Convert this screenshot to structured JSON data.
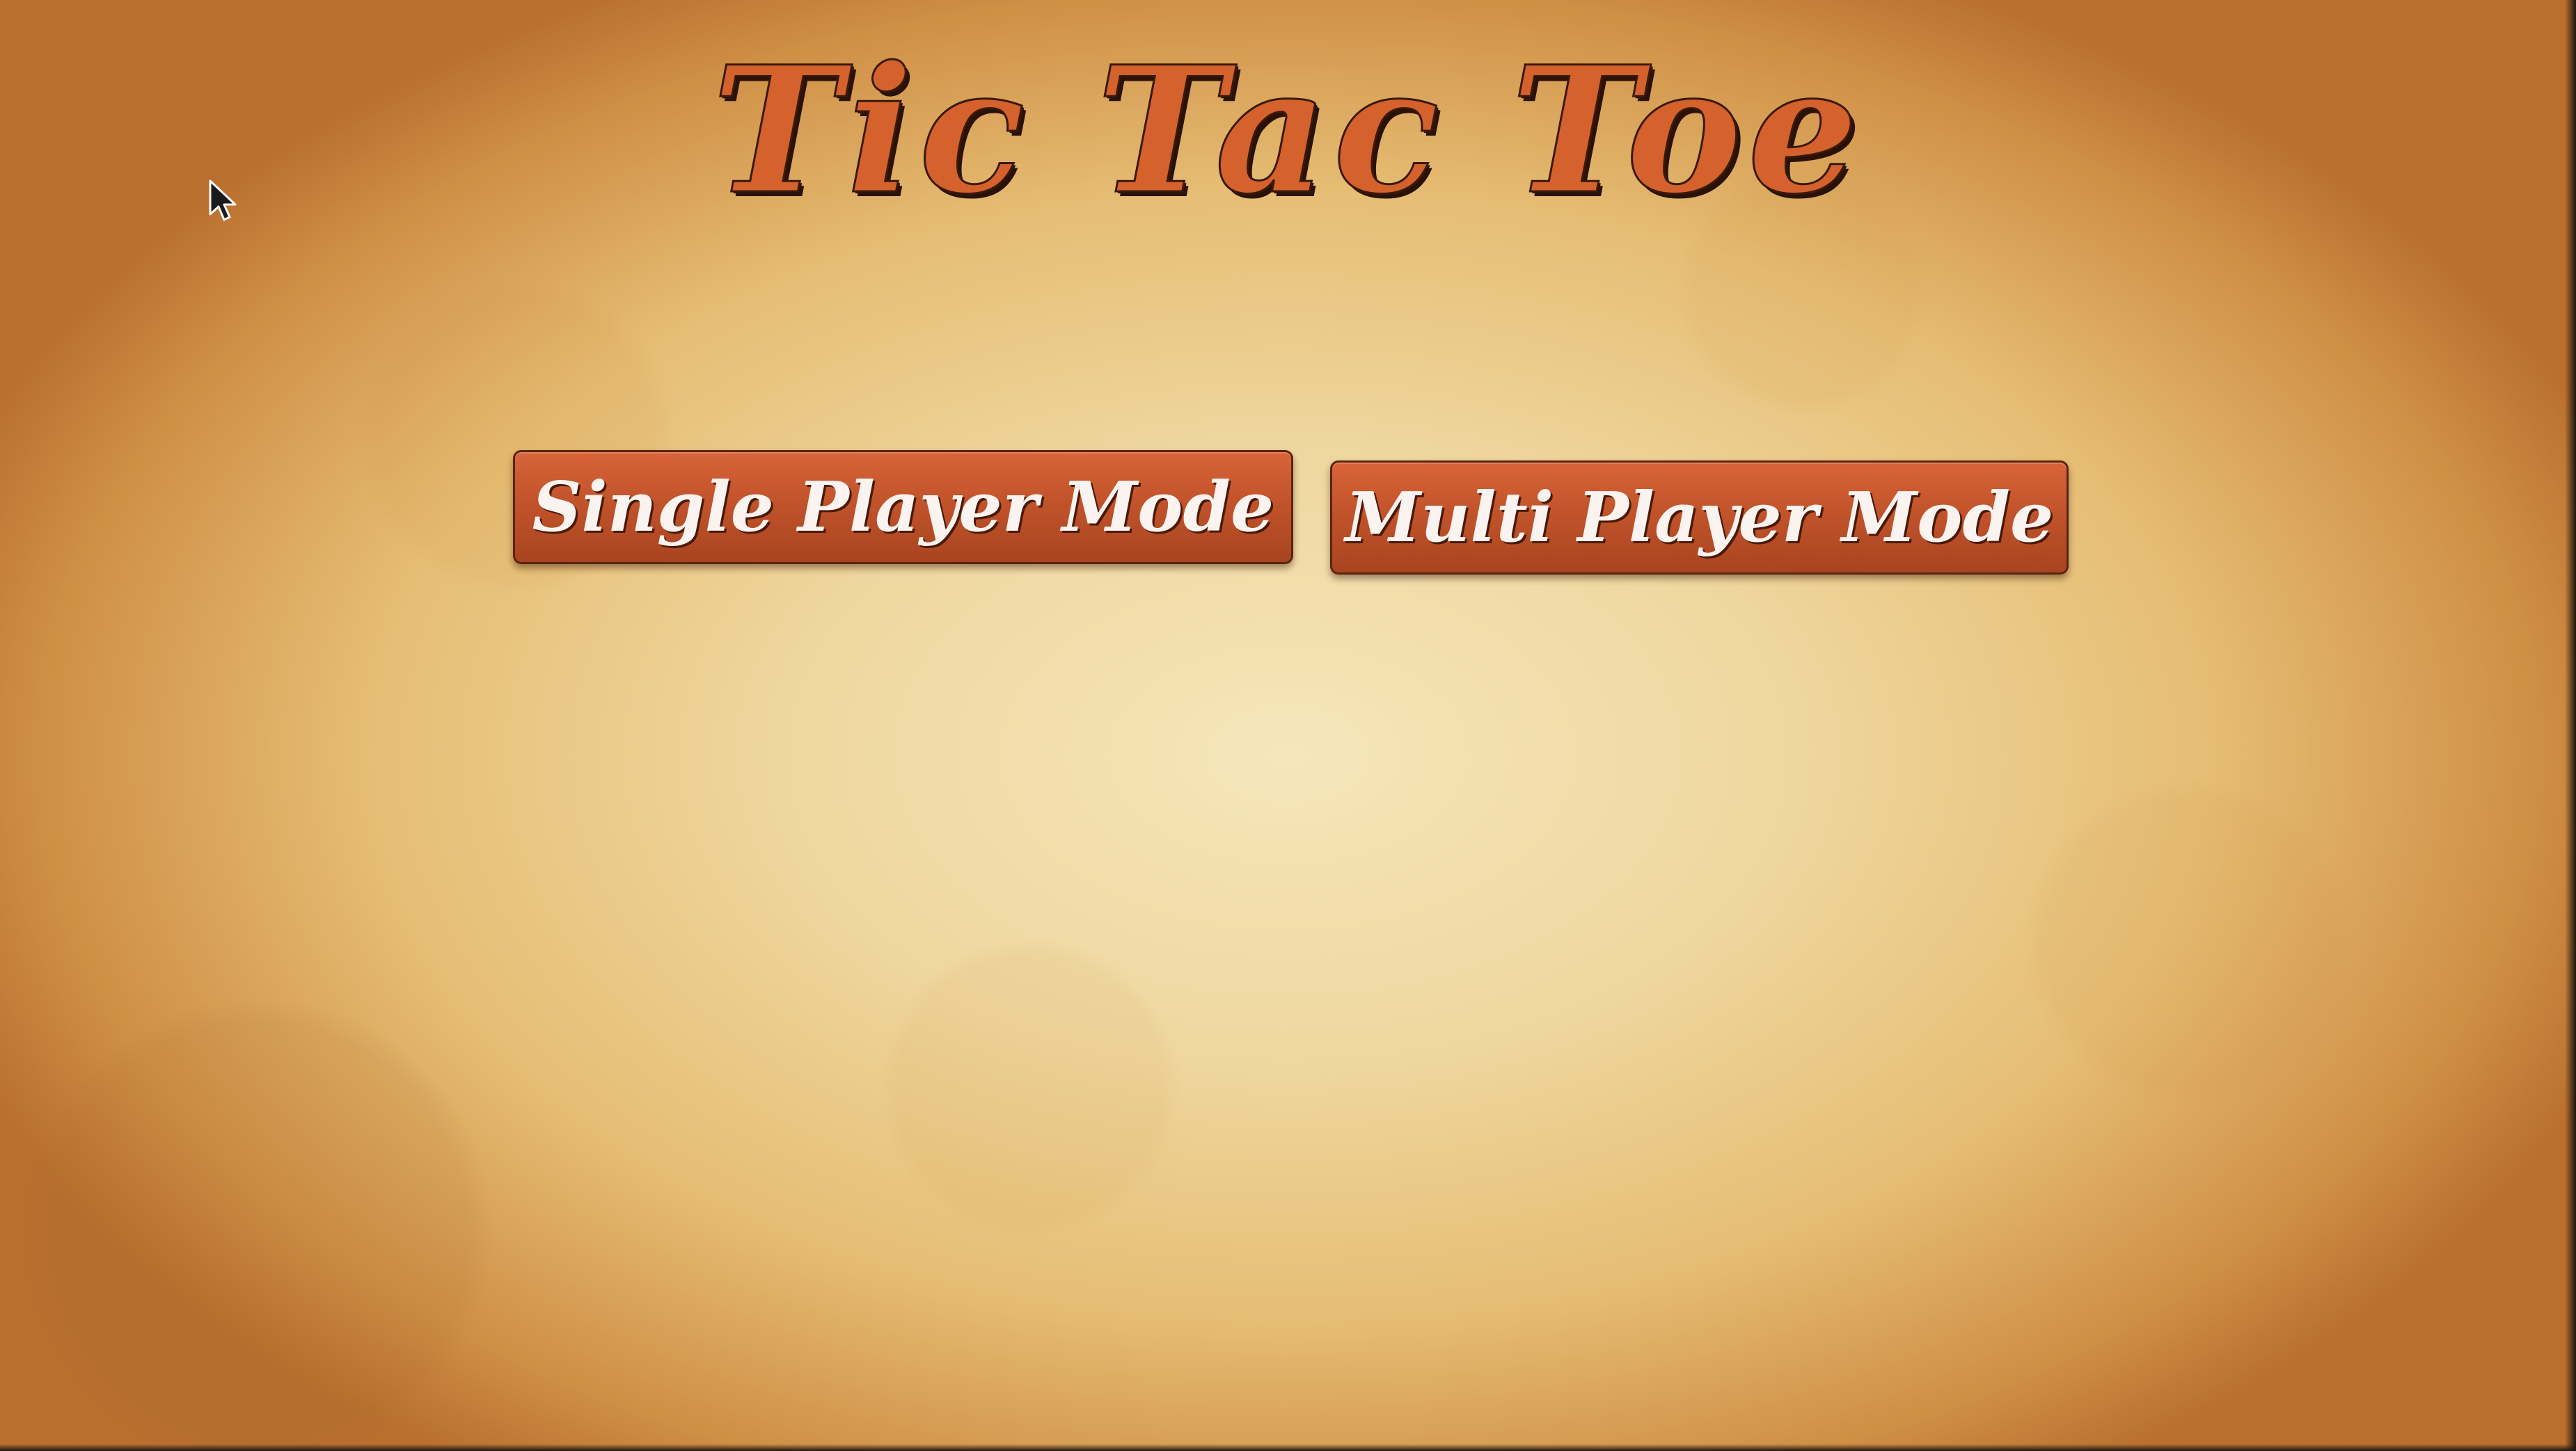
{
  "app": {
    "title": "Tic Tac Toe"
  },
  "menu": {
    "buttons": [
      {
        "label": "Single Player Mode"
      },
      {
        "label": "Multi Player Mode"
      }
    ]
  },
  "icons": {
    "pointer": "mouse-cursor-icon"
  },
  "colors": {
    "title": "#d5612c",
    "button": "#c4552c",
    "button_text": "#fbf3f0",
    "background_center": "#f6e6bb",
    "background_edge": "#b96f2e"
  }
}
